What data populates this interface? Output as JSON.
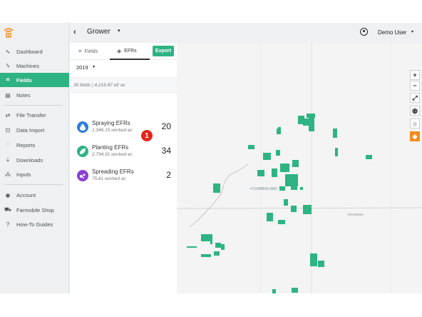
{
  "topbar": {
    "back_glyph": "‹",
    "context_title": "Grower",
    "context_caret": "▾",
    "user_name": "Demo User",
    "user_caret": "▾"
  },
  "sidebar": {
    "items": [
      {
        "label": "Dashboard",
        "icon": "pulse-icon"
      },
      {
        "label": "Machines",
        "icon": "bolt-icon"
      },
      {
        "label": "Fields",
        "icon": "field-icon",
        "active": true
      },
      {
        "label": "Notes",
        "icon": "notes-icon"
      },
      {
        "label": "File Transfer",
        "icon": "transfer-icon"
      },
      {
        "label": "Data Import",
        "icon": "import-icon"
      },
      {
        "label": "Reports",
        "icon": "reports-icon"
      },
      {
        "label": "Downloads",
        "icon": "download-icon"
      },
      {
        "label": "Inputs",
        "icon": "inputs-icon"
      },
      {
        "label": "Account",
        "icon": "account-icon"
      },
      {
        "label": "Farmobile Shop",
        "icon": "shop-icon"
      },
      {
        "label": "How-To Guides",
        "icon": "help-icon"
      }
    ]
  },
  "panel": {
    "tabs": [
      {
        "label": "Fields",
        "icon": "field-outline-icon"
      },
      {
        "label": "EFRs",
        "icon": "layers-icon",
        "active": true
      }
    ],
    "export_label": "Export",
    "year": "2019",
    "year_caret": "▾",
    "summary": "35 fields | 4,216.87 efr ac",
    "efrs": [
      {
        "title": "Spraying EFRs",
        "subtitle": "1,346.15 worked ac",
        "count": "20",
        "color": "#2f7bd8",
        "icon": "droplet-icon",
        "glyph": "💧"
      },
      {
        "title": "Planting EFRs",
        "subtitle": "2,794.91 worked ac",
        "count": "34",
        "color": "#2eb382",
        "icon": "leaf-icon",
        "glyph": "❦"
      },
      {
        "title": "Spreading EFRs",
        "subtitle": "75.81 worked ac",
        "count": "2",
        "color": "#8a3fd6",
        "icon": "spread-icon",
        "glyph": "⁘"
      }
    ],
    "badge": "1"
  },
  "map": {
    "labels": {
      "town1": "CUMBERLAND",
      "town2": "MASSENA"
    },
    "controls": [
      {
        "glyph": "+",
        "icon": "zoom-in-icon"
      },
      {
        "glyph": "−",
        "icon": "zoom-out-icon"
      },
      {
        "glyph": "⤢",
        "icon": "fullscreen-icon"
      },
      {
        "glyph": "◍",
        "icon": "globe-icon"
      },
      {
        "glyph": "☼",
        "icon": "weather-icon"
      },
      {
        "glyph": "◈",
        "icon": "layers-icon"
      }
    ],
    "field_color": "#2eb382"
  },
  "colors": {
    "accent": "#2eb382",
    "badge": "#e5261b",
    "logo": "#f28c1e"
  }
}
